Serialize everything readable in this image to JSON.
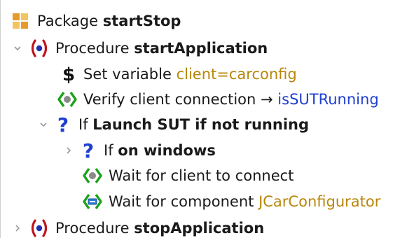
{
  "tree": {
    "rows": [
      {
        "kind": "Package",
        "name": "startStop"
      },
      {
        "kind": "Procedure",
        "name": "startApplication"
      },
      {
        "kind": "Set variable",
        "value": "client=carconfig"
      },
      {
        "kind": "Verify client connection",
        "arrow": "→",
        "link": "isSUTRunning"
      },
      {
        "kind": "If",
        "name": "Launch SUT if not running"
      },
      {
        "kind": "If",
        "name": "on windows"
      },
      {
        "kind": "Wait for client to connect"
      },
      {
        "kind": "Wait for component",
        "value": "JCarConfigurator"
      },
      {
        "kind": "Procedure",
        "name": "stopApplication"
      }
    ]
  },
  "colors": {
    "procedure_red": "#c0141c",
    "procedure_blue": "#1f2fb0",
    "wait_green": "#1aa31a",
    "question_blue": "#1f3fd0",
    "package_orange": "#e8a030",
    "value_gold": "#b8860b"
  },
  "icons": [
    "package-icon",
    "procedure-icon",
    "dollar-icon",
    "verify-connection-icon",
    "question-icon",
    "wait-client-icon",
    "wait-component-icon",
    "chevron-right-icon",
    "chevron-down-icon"
  ]
}
